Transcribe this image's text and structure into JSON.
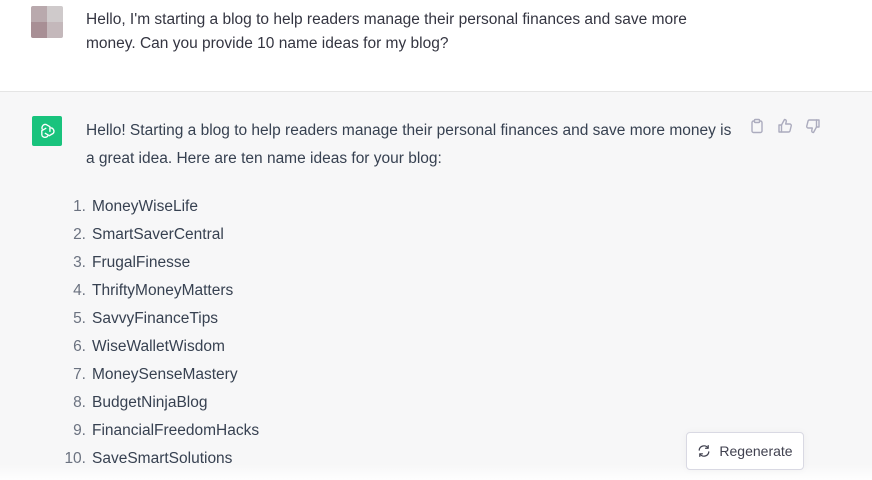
{
  "user_message": {
    "text": "Hello, I'm starting a blog to help readers manage their personal finances and save more money.  Can you provide 10 name ideas for my blog?"
  },
  "assistant_message": {
    "intro": "Hello! Starting a blog to help readers manage their personal finances and save more money is a great idea. Here are ten name ideas for your blog:",
    "names": [
      {
        "num": "1.",
        "text": "MoneyWiseLife"
      },
      {
        "num": "2.",
        "text": "SmartSaverCentral"
      },
      {
        "num": "3.",
        "text": "FrugalFinesse"
      },
      {
        "num": "4.",
        "text": "ThriftyMoneyMatters"
      },
      {
        "num": "5.",
        "text": "SavvyFinanceTips"
      },
      {
        "num": "6.",
        "text": "WiseWalletWisdom"
      },
      {
        "num": "7.",
        "text": "MoneySenseMastery"
      },
      {
        "num": "8.",
        "text": "BudgetNinjaBlog"
      },
      {
        "num": "9.",
        "text": "FinancialFreedomHacks"
      },
      {
        "num": "10.",
        "text": "SaveSmartSolutions"
      }
    ],
    "actions": [
      "clipboard-icon",
      "thumbs-up-icon",
      "thumbs-down-icon"
    ]
  },
  "regenerate": {
    "label": "Regenerate",
    "icon": "refresh-icon"
  },
  "colors": {
    "bot_avatar": "#19c37d",
    "assistant_bg": "#f7f7f8"
  }
}
